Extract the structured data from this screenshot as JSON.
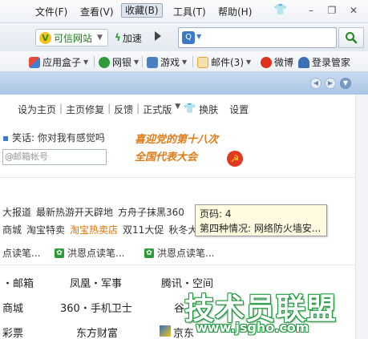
{
  "menubar": {
    "items": [
      "文件(F)",
      "查看(V)",
      "收藏(B)",
      "工具(T)",
      "帮助(H)"
    ],
    "win_minimize": "–",
    "win_restore": "❐",
    "win_close": "✕"
  },
  "toolbar": {
    "trusted_label": "可信网站",
    "accelerate_label": "加速",
    "search_value": ""
  },
  "favbar": {
    "items": [
      {
        "label": "应用盒子",
        "icon": "app-box-icon",
        "color": "#3b7dd8"
      },
      {
        "label": "网银",
        "icon": "bank-icon",
        "color": "#2e9a3a"
      },
      {
        "label": "游戏",
        "icon": "game-icon",
        "color": "#4a7fc0"
      },
      {
        "label": "邮件(3)",
        "icon": "mail-icon",
        "color": "#e8a030"
      },
      {
        "label": "微博",
        "icon": "weibo-icon",
        "color": "#e0311f"
      },
      {
        "label": "登录管家",
        "icon": "key-icon",
        "color": "#3b6fb8"
      }
    ]
  },
  "page": {
    "topnav": [
      "设为主页",
      "主页修复",
      "反馈",
      "正式版",
      "换肤",
      "设置"
    ],
    "joke_label": "笑话: 你对我有感觉吗",
    "mail_placeholder": "邮箱帐号",
    "banner_line1": "喜迎党的第十八次",
    "banner_line2": "全国代表大会",
    "news_items": [
      "大报道",
      "最新热游开天辟地",
      "方舟子抹黑360"
    ],
    "shop_items": [
      "商城",
      "淘宝特卖",
      "淘宝热卖店",
      "双11大促",
      "秋冬大"
    ],
    "tooltip_line1": "页码: 4",
    "tooltip_line2": "第四种情况: 网络防火墙安...",
    "read_items": [
      "点读笔...",
      "洪恩点读笔...",
      "洪恩点读笔..."
    ],
    "sites": [
      [
        "・邮箱",
        "凤凰・军事",
        "腾讯・空间"
      ],
      [
        "商城",
        "360・手机卫士",
        "谷"
      ],
      [
        "彩票",
        "东方财富",
        "京东"
      ]
    ]
  },
  "watermark": {
    "title": "技术员联盟",
    "url": "www.jsgho.com"
  },
  "colors": {
    "accent_green": "#1f8a1f",
    "tabstrip_blue": "#a9c5e4",
    "banner_orange": "#e07b1a"
  }
}
